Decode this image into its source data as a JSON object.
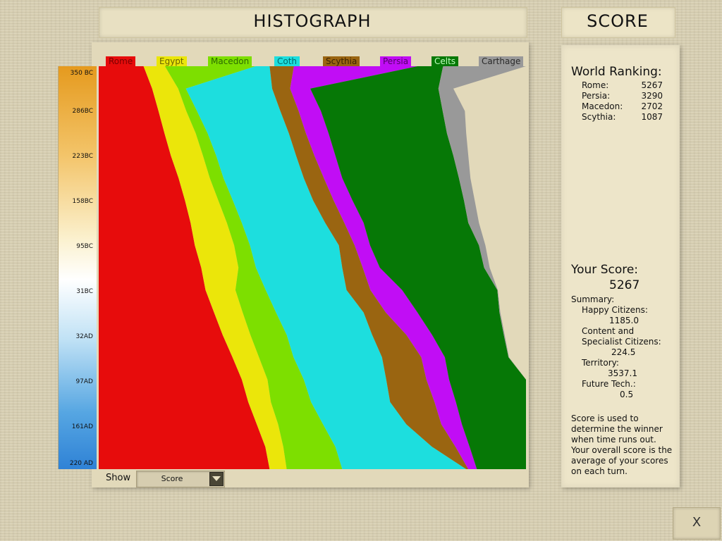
{
  "header": {
    "title": "HISTOGRAPH",
    "score_title": "SCORE"
  },
  "legend": [
    {
      "name": "Rome",
      "color": "#e70c0c",
      "text_color": "#7a0000"
    },
    {
      "name": "Egypt",
      "color": "#ebe60a",
      "text_color": "#6b6400"
    },
    {
      "name": "Macedon",
      "color": "#7ddf00",
      "text_color": "#2c6a00"
    },
    {
      "name": "Coth",
      "color": "#1ddede",
      "text_color": "#006a6a"
    },
    {
      "name": "Scythia",
      "color": "#9a6511",
      "text_color": "#3a2200"
    },
    {
      "name": "Persia",
      "color": "#c10df5",
      "text_color": "#55006a"
    },
    {
      "name": "Celts",
      "color": "#067806",
      "text_color": "#bfffbf"
    },
    {
      "name": "Carthage",
      "color": "#999999",
      "text_color": "#2a2a2a"
    }
  ],
  "timeline_labels": [
    "350 BC",
    "286BC",
    "223BC",
    "158BC",
    "95BC",
    "31BC",
    "32AD",
    "97AD",
    "161AD",
    "220 AD"
  ],
  "chart_data": {
    "type": "area",
    "stacked": "normalized",
    "series_order": [
      "Rome",
      "Egypt",
      "Macedon",
      "Coth",
      "Scythia",
      "Persia",
      "Celts",
      "Carthage"
    ],
    "time_axis": [
      "350 BC",
      "286BC",
      "223BC",
      "158BC",
      "95BC",
      "31BC",
      "32AD",
      "97AD",
      "161AD",
      "220 AD"
    ],
    "boundaries_pct": [
      [
        10.5,
        15.5,
        36.7,
        40.0,
        45.7,
        74.6,
        80.6,
        100
      ],
      [
        12.5,
        18.6,
        20.4,
        40.6,
        44.8,
        49.5,
        79.5,
        83.0
      ],
      [
        14.0,
        20.5,
        23.0,
        42.5,
        46.8,
        52.0,
        80.5,
        85.7
      ],
      [
        15.4,
        22.7,
        25.5,
        44.5,
        48.5,
        53.8,
        81.5,
        86.0
      ],
      [
        16.9,
        24.4,
        27.5,
        46.2,
        50.5,
        55.4,
        83.0,
        86.5
      ],
      [
        18.7,
        26.0,
        29.2,
        48.0,
        52.7,
        57.0,
        84.3,
        87.0
      ],
      [
        20.2,
        28.0,
        31.4,
        50.2,
        55.0,
        59.4,
        85.5,
        88.0
      ],
      [
        21.5,
        30.0,
        33.5,
        53.0,
        57.5,
        62.0,
        86.5,
        89.0
      ],
      [
        22.5,
        31.7,
        35.4,
        56.2,
        59.9,
        63.5,
        89.0,
        90.5
      ],
      [
        24.0,
        32.7,
        36.8,
        57.0,
        61.8,
        65.8,
        90.2,
        91.5
      ],
      [
        25.0,
        32.0,
        39.1,
        58.0,
        63.6,
        71.0,
        93.3,
        93.4
      ],
      [
        27.0,
        33.7,
        41.5,
        62.0,
        67.2,
        74.6,
        93.8,
        94.0
      ],
      [
        29.0,
        35.5,
        44.0,
        64.0,
        72.0,
        78.0,
        94.8,
        95.0
      ],
      [
        31.3,
        37.5,
        45.6,
        66.3,
        75.5,
        81.0,
        95.9,
        96.0
      ],
      [
        33.5,
        39.5,
        48.0,
        67.3,
        76.7,
        82.0,
        100,
        100
      ],
      [
        35.0,
        40.3,
        49.7,
        68.2,
        78.6,
        83.6,
        100,
        100
      ],
      [
        37.0,
        42.0,
        52.5,
        72.0,
        80.2,
        85.0,
        100,
        100
      ],
      [
        39.0,
        43.2,
        55.4,
        78.0,
        83.5,
        86.8,
        100,
        100
      ],
      [
        40.0,
        44.0,
        57.0,
        86.0,
        86.5,
        88.5,
        100,
        100
      ]
    ]
  },
  "controls": {
    "show_label": "Show",
    "show_value": "Score"
  },
  "world_ranking": {
    "title": "World Ranking:",
    "rows": [
      {
        "name": "Rome:",
        "score": "5267"
      },
      {
        "name": "Persia:",
        "score": "3290"
      },
      {
        "name": "Macedon:",
        "score": "2702"
      },
      {
        "name": "Scythia:",
        "score": "1087"
      }
    ]
  },
  "your_score": {
    "title": "Your Score:",
    "value": "5267",
    "summary_label": "Summary:",
    "happy_label": "Happy Citizens:",
    "happy_value": "1185.0",
    "content_label_1": "Content and",
    "content_label_2": "Specialist Citizens:",
    "content_value": "224.5",
    "territory_label": "Territory:",
    "territory_value": "3537.1",
    "future_label": "Future Tech.:",
    "future_value": "0.5"
  },
  "note": "Score is used to determine the winner when time runs out. Your overall score is the average of your scores on each turn.",
  "close_button": {
    "label": "X"
  }
}
